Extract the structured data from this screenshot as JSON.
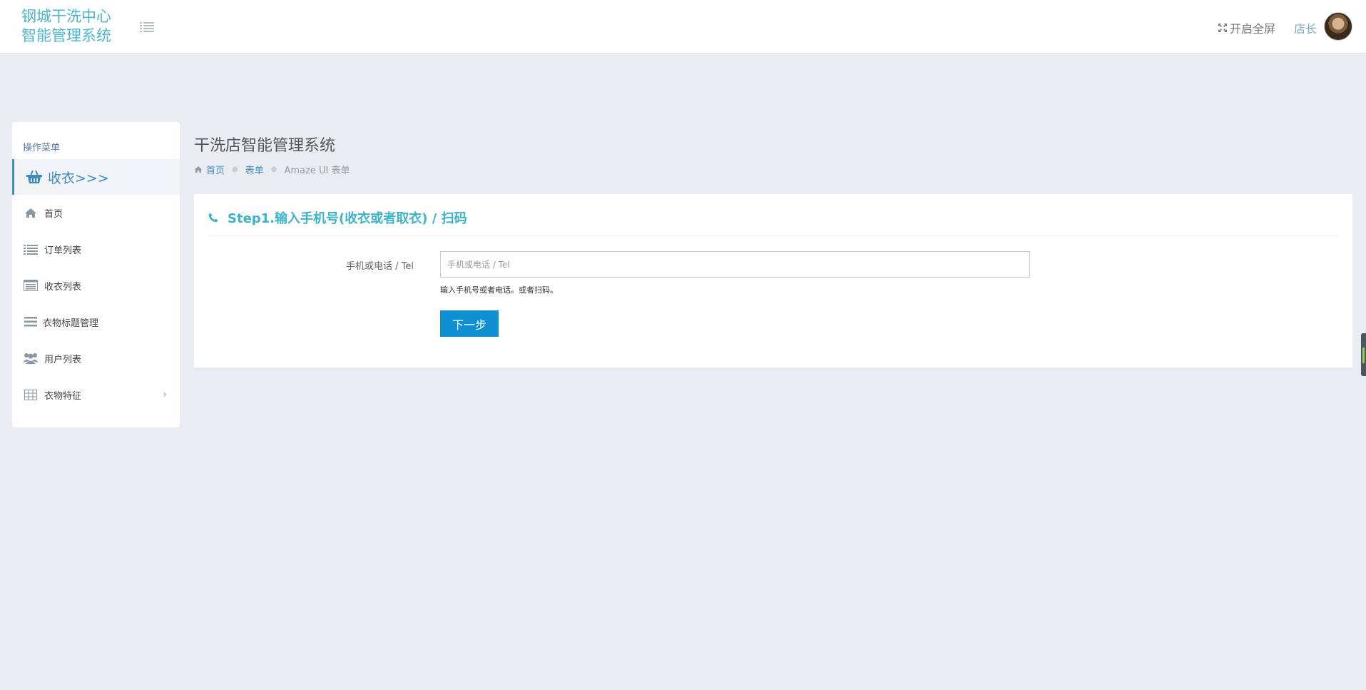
{
  "header": {
    "logo_line1": "钢城干洗中心",
    "logo_line2": "智能管理系统",
    "fullscreen_label": "开启全屏",
    "user_name": "店长",
    "accent_color": "#4bb7cf"
  },
  "sidebar": {
    "caption": "操作菜单",
    "active": {
      "label": "收衣>>>",
      "icon": "basket-icon"
    },
    "items": [
      {
        "label": "首页",
        "icon": "home-icon"
      },
      {
        "label": "订单列表",
        "icon": "list-icon"
      },
      {
        "label": "收衣列表",
        "icon": "table-list-icon"
      },
      {
        "label": "衣物标题管理",
        "icon": "bars-icon"
      },
      {
        "label": "用户列表",
        "icon": "users-icon"
      },
      {
        "label": "衣物特征",
        "icon": "grid-icon",
        "has_submenu": true
      }
    ]
  },
  "main": {
    "page_title": "干洗店智能管理系统",
    "breadcrumb": {
      "home": "首页",
      "section": "表单",
      "current": "Amaze UI 表单"
    },
    "card": {
      "title": "Step1.输入手机号(收衣或者取衣) / 扫码",
      "field_label": "手机或电话 / Tel",
      "field_value": "",
      "field_placeholder": "手机或电话 / Tel",
      "field_help": "输入手机号或者电话。或者扫码。",
      "next_button": "下一步",
      "button_color": "#0e90d2"
    }
  }
}
